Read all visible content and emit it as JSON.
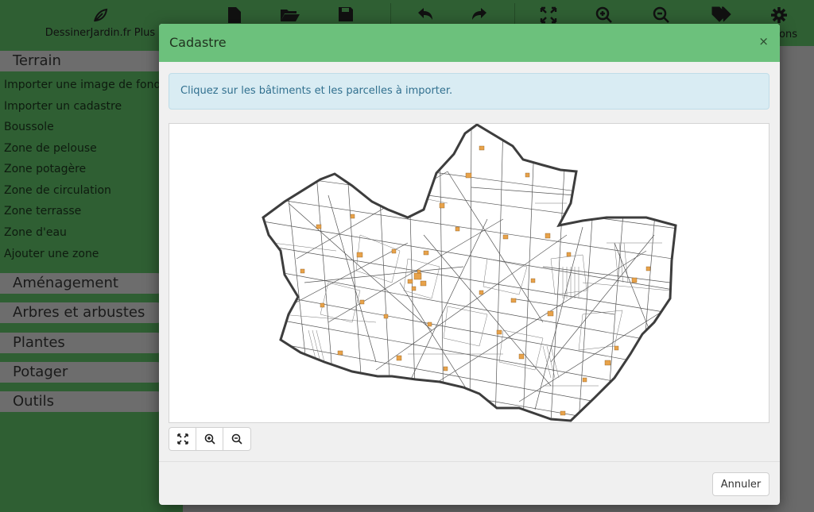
{
  "app": {
    "brand": "DessinerJardin.fr Plus",
    "options_label_partial": "ons"
  },
  "toolbar": {
    "icons": [
      "new-file-icon",
      "open-folder-icon",
      "save-icon",
      "undo-icon",
      "redo-icon",
      "fit-screen-icon",
      "zoom-in-icon",
      "zoom-out-icon",
      "tags-icon",
      "gear-icon"
    ]
  },
  "sidebar": {
    "sections": [
      {
        "label": "Terrain"
      },
      {
        "label": "Aménagement"
      },
      {
        "label": "Arbres et arbustes"
      },
      {
        "label": "Plantes"
      },
      {
        "label": "Potager"
      },
      {
        "label": "Outils"
      }
    ],
    "terrain_items": [
      "Importer une image de fond",
      "Importer un cadastre",
      "Boussole",
      "Zone de pelouse",
      "Zone potagère",
      "Zone de circulation",
      "Zone terrasse",
      "Zone d'eau",
      "Ajouter une zone"
    ]
  },
  "modal": {
    "title": "Cadastre",
    "close": "×",
    "info": "Cliquez sur les bâtiments et les parcelles à importer.",
    "cancel": "Annuler"
  },
  "colors": {
    "header_green": "#6cc17c",
    "dim_green": "#2f5f33",
    "alert_bg": "#d9ecf3",
    "alert_text": "#31708f",
    "building_orange": "#e8a24a"
  }
}
